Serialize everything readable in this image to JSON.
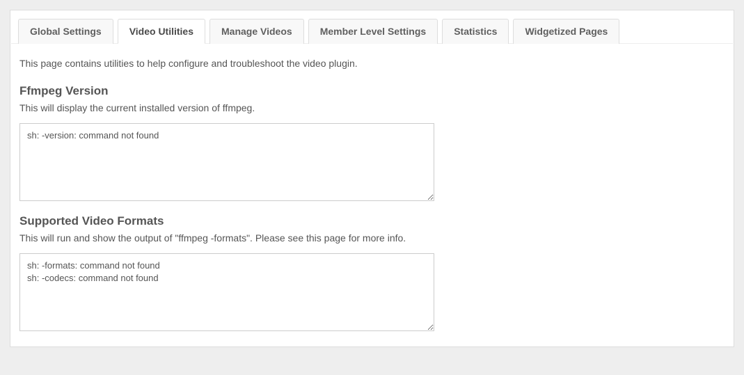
{
  "tabs": [
    {
      "label": "Global Settings",
      "active": false
    },
    {
      "label": "Video Utilities",
      "active": true
    },
    {
      "label": "Manage Videos",
      "active": false
    },
    {
      "label": "Member Level Settings",
      "active": false
    },
    {
      "label": "Statistics",
      "active": false
    },
    {
      "label": "Widgetized Pages",
      "active": false
    }
  ],
  "intro": "This page contains utilities to help configure and troubleshoot the video plugin.",
  "sections": [
    {
      "heading": "Ffmpeg Version",
      "description": "This will display the current installed version of ffmpeg.",
      "output": "sh: -version: command not found"
    },
    {
      "heading": "Supported Video Formats",
      "description": "This will run and show the output of \"ffmpeg -formats\". Please see this page for more info.",
      "output": "sh: -formats: command not found\nsh: -codecs: command not found"
    }
  ]
}
